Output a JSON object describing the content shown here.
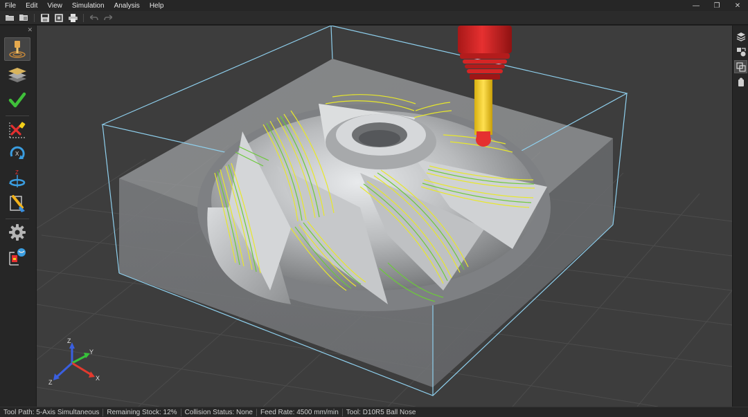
{
  "menu": [
    "File",
    "Edit",
    "View",
    "Simulation",
    "Analysis",
    "Help"
  ],
  "window_controls": {
    "minimize": "—",
    "restore": "❐",
    "close": "✕"
  },
  "toolbar_icons": [
    "open-folder-icon",
    "open-file-icon",
    "save-icon",
    "save-as-icon",
    "print-icon",
    "undo-icon",
    "redo-icon"
  ],
  "left_panel": {
    "close_glyph": "✕",
    "tools": [
      {
        "icon": "tool-holder-icon",
        "active": true
      },
      {
        "icon": "layers-stock-icon",
        "active": false
      },
      {
        "icon": "verify-check-icon",
        "active": false
      },
      {
        "icon": "collision-check-icon",
        "active": false
      },
      {
        "icon": "rotate-x-icon",
        "active": false
      },
      {
        "icon": "rotate-z-icon",
        "active": false
      },
      {
        "icon": "brush-paint-icon",
        "active": false
      },
      {
        "icon": "settings-gear-icon",
        "active": false
      },
      {
        "icon": "machine-report-icon",
        "active": false
      }
    ]
  },
  "right_panel": {
    "tools": [
      {
        "icon": "layers-icon",
        "active": false
      },
      {
        "icon": "shapes-icon",
        "active": false
      },
      {
        "icon": "view-cube-icon",
        "active": true
      },
      {
        "icon": "part-view-icon",
        "active": false
      }
    ]
  },
  "viewport": {
    "axis_labels": {
      "x": "X",
      "y": "Y",
      "z_up": "Z",
      "z_down": "Z"
    },
    "colors": {
      "background": "#3d3d3d",
      "grid": "#4c4c4c",
      "bounding_box": "#8fd0ee",
      "stock": "#8a8c8e",
      "part": "#c4c6c8",
      "toolpath_yellow": "#e8e82a",
      "toolpath_green": "#6cc93a",
      "spindle": "#d42121",
      "tool": "#f2cf1a",
      "axis_x": "#e33a2e",
      "axis_y": "#36c23a",
      "axis_z": "#3a5fe0"
    }
  },
  "status": {
    "tool_path": "Tool Path: 5-Axis Simultaneous",
    "remaining_stock": "Remaining Stock: 12%",
    "collision_status": "Collision Status: None",
    "feed_rate": "Feed Rate: 4500 mm/min",
    "tool": "Tool: D10R5 Ball Nose"
  }
}
